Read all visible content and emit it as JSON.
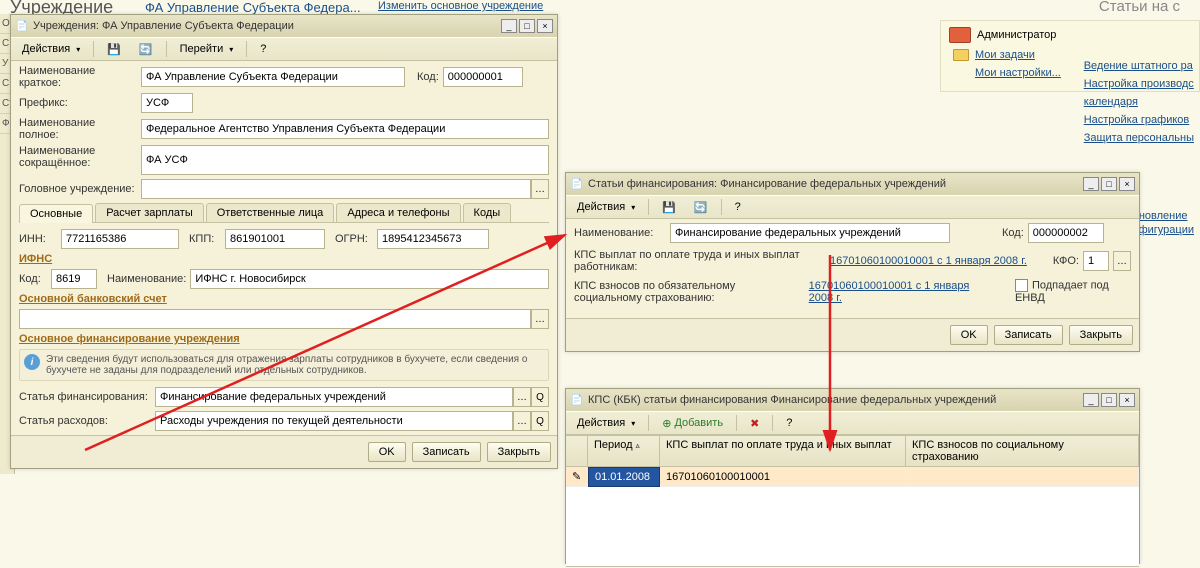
{
  "header": {
    "page_title": "Учреждение",
    "breadcrumb": "ФА Управление Субъекта Федера...",
    "change_link": "Изменить основное учреждение",
    "right_title": "Статьи на с"
  },
  "user_panel": {
    "name": "Администратор",
    "my_tasks": "Мои задачи",
    "my_settings": "Мои настройки..."
  },
  "right_links": {
    "l1": "Ведение штатного ра",
    "l2": "Настройка производс",
    "l2b": "календаря",
    "l3": "Настройка графиков",
    "l4": "Защита персональны"
  },
  "right_bot": {
    "b1": "бновление",
    "b2": "нфигурации"
  },
  "win1": {
    "title": "Учреждения: ФА Управление Субъекта Федерации",
    "toolbar": {
      "actions": "Действия",
      "go": "Перейти"
    },
    "fields": {
      "short_name_lbl": "Наименование краткое:",
      "short_name": "ФА Управление Субъекта Федерации",
      "code_lbl": "Код:",
      "code": "000000001",
      "prefix_lbl": "Префикс:",
      "prefix": "УСФ",
      "full_name_lbl": "Наименование полное:",
      "full_name": "Федеральное Агентство Управления Субъекта Федерации",
      "abbr_lbl": "Наименование сокращённое:",
      "abbr": "ФА УСФ",
      "head_lbl": "Головное учреждение:"
    },
    "tabs": [
      "Основные",
      "Расчет зарплаты",
      "Ответственные лица",
      "Адреса и телефоны",
      "Коды"
    ],
    "inn_lbl": "ИНН:",
    "inn": "7721165386",
    "kpp_lbl": "КПП:",
    "kpp": "861901001",
    "ogrn_lbl": "ОГРН:",
    "ogrn": "1895412345673",
    "ifns_hd": "ИФНС",
    "ifns_code_lbl": "Код:",
    "ifns_code": "8619",
    "ifns_name_lbl": "Наименование:",
    "ifns_name": "ИФНС г. Новосибирск",
    "bank_hd": "Основной банковский счет",
    "fin_hd": "Основное финансирование учреждения",
    "info": "Эти сведения будут использоваться для отражения зарплаты сотрудников в бухучете, если сведения о бухучете не заданы для подразделений или отдельных сотрудников.",
    "fin_art_lbl": "Статья финансирования:",
    "fin_art": "Финансирование федеральных учреждений",
    "exp_art_lbl": "Статья расходов:",
    "exp_art": "Расходы учреждения по текущей деятельности",
    "buttons": {
      "ok": "OK",
      "save": "Записать",
      "close": "Закрыть"
    }
  },
  "win2": {
    "title": "Статьи финансирования: Финансирование федеральных учреждений",
    "toolbar": {
      "actions": "Действия"
    },
    "name_lbl": "Наименование:",
    "name": "Финансирование федеральных учреждений",
    "code_lbl": "Код:",
    "code": "000000002",
    "kps1_lbl": "КПС выплат по оплате труда и иных выплат работникам:",
    "kps1_link": "16701060100010001 с 1 января 2008 г.",
    "kfo_lbl": "КФО:",
    "kfo": "1",
    "kps2_lbl": "КПС взносов по обязательному социальному страхованию:",
    "kps2_link": "16701060100010001 с 1 января 2008 г.",
    "envd_lbl": "Подпадает под ЕНВД",
    "buttons": {
      "ok": "OK",
      "save": "Записать",
      "close": "Закрыть"
    }
  },
  "win3": {
    "title": "КПС (КБК) статьи финансирования Финансирование федеральных учреждений",
    "toolbar": {
      "actions": "Действия",
      "add": "Добавить"
    },
    "columns": {
      "c0": "",
      "c1": "Период",
      "c2": "КПС выплат по оплате труда и иных выплат",
      "c3": "КПС взносов по социальному страхованию"
    },
    "row": {
      "date": "01.01.2008",
      "kps": "16701060100010001"
    }
  },
  "leftbar": [
    "О",
    "С",
    "У",
    "Сп",
    "Ст",
    "Ф"
  ]
}
